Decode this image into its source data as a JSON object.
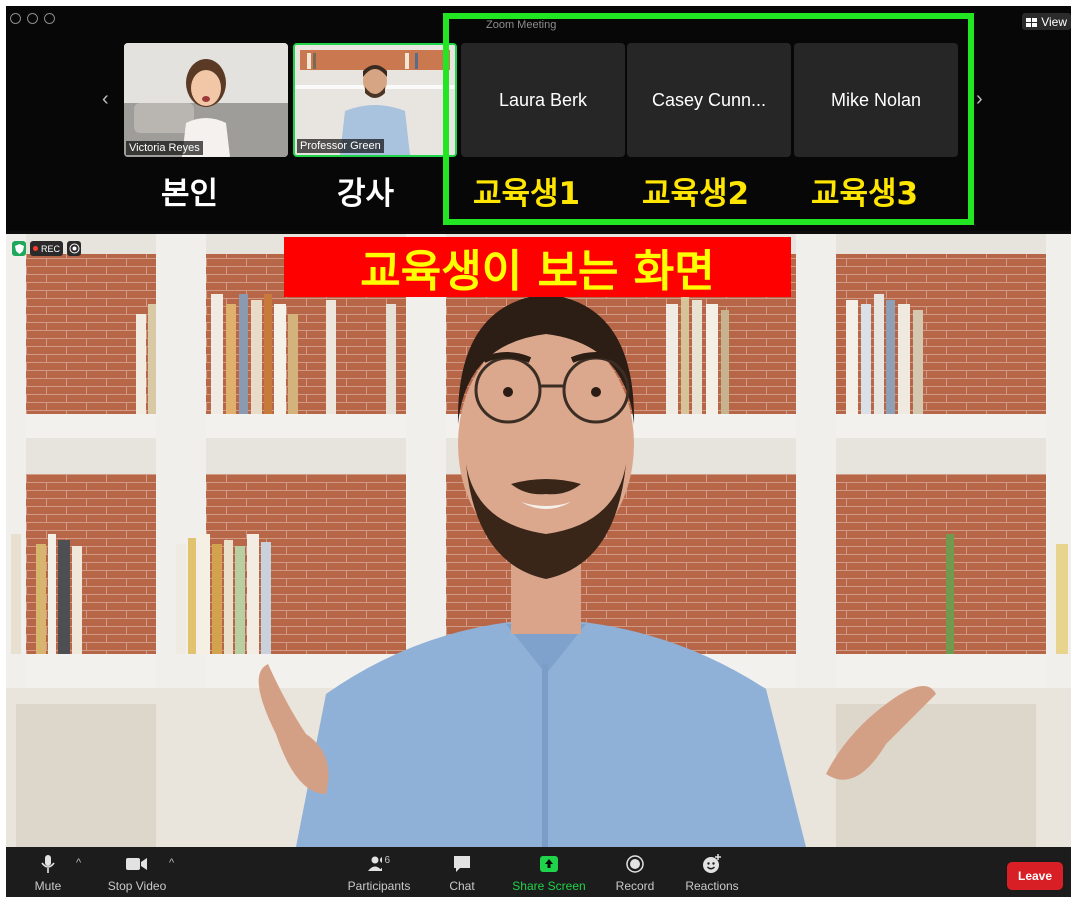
{
  "window": {
    "view_label": "View"
  },
  "meeting": {
    "title": "Zoom Meeting"
  },
  "nav": {
    "prev": "‹",
    "next": "›"
  },
  "participants_strip": [
    {
      "name": "Victoria Reyes"
    },
    {
      "name": "Professor Green"
    },
    {
      "name": "Laura Berk"
    },
    {
      "name": "Casey Cunn..."
    },
    {
      "name": "Mike Nolan"
    }
  ],
  "annotations": {
    "self": "본인",
    "instructor": "강사",
    "trainee1": "교육생1",
    "trainee2": "교육생2",
    "trainee3": "교육생3",
    "main_title": "교육생이 보는 화면",
    "highlight_color": "#22e622",
    "title_bg_color": "#ff0000",
    "title_text_color": "#ffff00"
  },
  "status": {
    "rec": "REC"
  },
  "toolbar": {
    "mute": "Mute",
    "stop_video": "Stop Video",
    "participants": "Participants",
    "participants_count": "6",
    "chat": "Chat",
    "share_screen": "Share Screen",
    "record": "Record",
    "reactions": "Reactions",
    "leave": "Leave"
  }
}
